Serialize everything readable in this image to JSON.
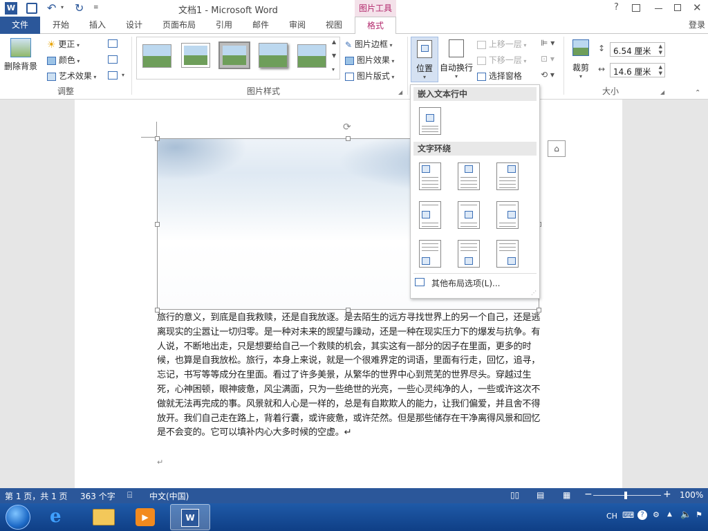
{
  "window": {
    "title": "文档1 - Microsoft Word",
    "context_tab_group": "图片工具",
    "help": "?",
    "signin": "登录"
  },
  "tabs": [
    "文件",
    "开始",
    "插入",
    "设计",
    "页面布局",
    "引用",
    "邮件",
    "审阅",
    "视图",
    "格式"
  ],
  "ribbon": {
    "remove_bg": "删除背景",
    "corrections": "更正",
    "color": "颜色",
    "artistic": "艺术效果",
    "adjust_group": "调整",
    "styles_group": "图片样式",
    "border": "图片边框",
    "effects": "图片效果",
    "layout": "图片版式",
    "position": "位置",
    "wrap_text": "自动换行",
    "bring_forward": "上移一层",
    "send_backward": "下移一层",
    "selection_pane": "选择窗格",
    "crop": "裁剪",
    "height": "6.54 厘米",
    "width": "14.6 厘米",
    "size_group": "大小"
  },
  "dropdown": {
    "inline_header": "嵌入文本行中",
    "wrap_header": "文字环绕",
    "more_options": "其他布局选项(L)..."
  },
  "document": {
    "paragraph": "旅行的意义，到底是自我救赎，还是自我放逐。是去陌生的远方寻找世界上的另一个自己，还是逃离现实的尘嚣让一切归零。是一种对未来的觊望与躁动，还是一种在现实压力下的爆发与抗争。有人说，不断地出走，只是想要给自己一个救赎的机会，其实这有一部分的因子在里面，更多的时候，也算是自我放松。旅行，本身上来说，就是一个很难界定的词语，里面有行走，回忆，追寻，忘记，书写等等成分在里面。看过了许多美景，从繁华的世界中心到荒芜的世界尽头。穿越过生死，心神困顿，眼神疲惫，风尘满面，只为一些绝世的光亮，一些心灵纯净的人，一些或许这次不做就无法再完成的事。风景就和人心是一样的，总是有自欺欺人的能力，让我们偏爱，并且舍不得放开。我们自己走在路上，背着行囊，或许疲惫，或许茫然。但是那些储存在干净离得风景和回忆是不会变的。它可以填补内心大多时候的空虚。↵",
    "empty_para": "↵"
  },
  "status": {
    "page": "第 1 页，共 1 页",
    "words": "363 个字",
    "language": "中文(中国)",
    "zoom": "100%"
  },
  "taskbar": {
    "ime": "CH"
  },
  "colors": {
    "accent": "#2b579a",
    "context_tab": "#b2286c"
  }
}
